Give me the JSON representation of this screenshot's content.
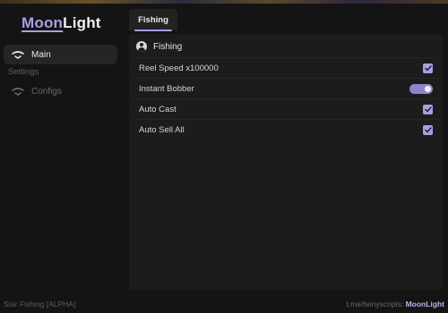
{
  "app": {
    "logo_part1": "Moon",
    "logo_part2": "Light",
    "accent_color": "#a79ee6"
  },
  "sidebar": {
    "items": [
      {
        "label": "Main",
        "icon": "link-icon",
        "active": true
      }
    ],
    "section_label": "Settings",
    "settings_items": [
      {
        "label": "Configs",
        "icon": "link-icon",
        "active": false
      }
    ]
  },
  "tabs": [
    {
      "label": "Fishing",
      "active": true
    }
  ],
  "group": {
    "title": "Fishing",
    "icon": "user-circle-icon",
    "rows": [
      {
        "label": "Reel Speed x100000",
        "control": "checkbox",
        "checked": true
      },
      {
        "label": "Instant Bobber",
        "control": "toggle",
        "on": true
      },
      {
        "label": "Auto Cast",
        "control": "checkbox",
        "checked": true
      },
      {
        "label": "Auto Sell All",
        "control": "checkbox",
        "checked": true
      }
    ]
  },
  "footer": {
    "left": "Star Fishing [ALPHA]",
    "right_prefix": "t.me/henyscripts:",
    "right_brand": "MoonLight"
  }
}
